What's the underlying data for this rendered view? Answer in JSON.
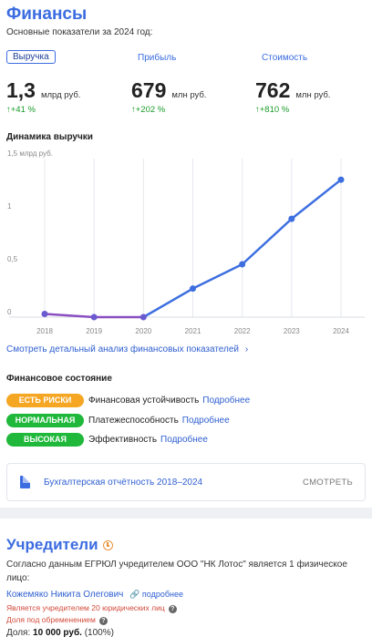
{
  "finance": {
    "title": "Финансы",
    "subtitle": "Основные показатели за 2024 год:",
    "metrics": [
      {
        "label": "Выручка",
        "value": "1,3",
        "unit": "млрд руб.",
        "growth": "↑+41 %"
      },
      {
        "label": "Прибыль",
        "value": "679",
        "unit": "млн руб.",
        "growth": "↑+202 %"
      },
      {
        "label": "Стоимость",
        "value": "762",
        "unit": "млн руб.",
        "growth": "↑+810 %"
      }
    ],
    "chart_title": "Динамика выручки",
    "detail_link": "Смотреть детальный анализ финансовых показателей",
    "state_title": "Финансовое состояние",
    "state": [
      {
        "badge": "ЕСТЬ РИСКИ",
        "badge_color": "#f5a623",
        "label": "Финансовая устойчивость",
        "more": "Подробнее"
      },
      {
        "badge": "НОРМАЛЬНАЯ",
        "badge_color": "#1fb83a",
        "label": "Платежеспособность",
        "more": "Подробнее"
      },
      {
        "badge": "ВЫСОКАЯ",
        "badge_color": "#1fb83a",
        "label": "Эффективность",
        "more": "Подробнее"
      }
    ],
    "report": {
      "title": "Бухгалтерская отчётность 2018–2024",
      "action": "СМОТРЕТЬ"
    }
  },
  "chart_data": {
    "type": "line",
    "x": [
      "2018",
      "2019",
      "2020",
      "2021",
      "2022",
      "2023",
      "2024"
    ],
    "y_ticks": [
      "1,5 млрд руб.",
      "1",
      "0,5",
      "0"
    ],
    "ylim": [
      0,
      1.5
    ],
    "series": [
      {
        "values": [
          0.03,
          0.0,
          0.0,
          0.27,
          0.5,
          0.93,
          1.3
        ]
      }
    ],
    "colors": {
      "line": "#3d6fe0",
      "early_segment": "#8a4fc2",
      "points": "#3d6fe0"
    },
    "grid": "vertical"
  },
  "founders": {
    "title": "Учредители",
    "text": "Согласно данным ЕГРЮЛ учредителем ООО \"НК Лотос\" является 1 физическое лицо:",
    "person_name": "Кожемяко Никита Олегович",
    "person_more": "подробнее",
    "note1": "Является учредителем 20 юридических лиц",
    "note2": "Доля под обременением",
    "share_label": "Доля:",
    "share_value": "10 000 руб.",
    "share_percent": "(100%)"
  }
}
